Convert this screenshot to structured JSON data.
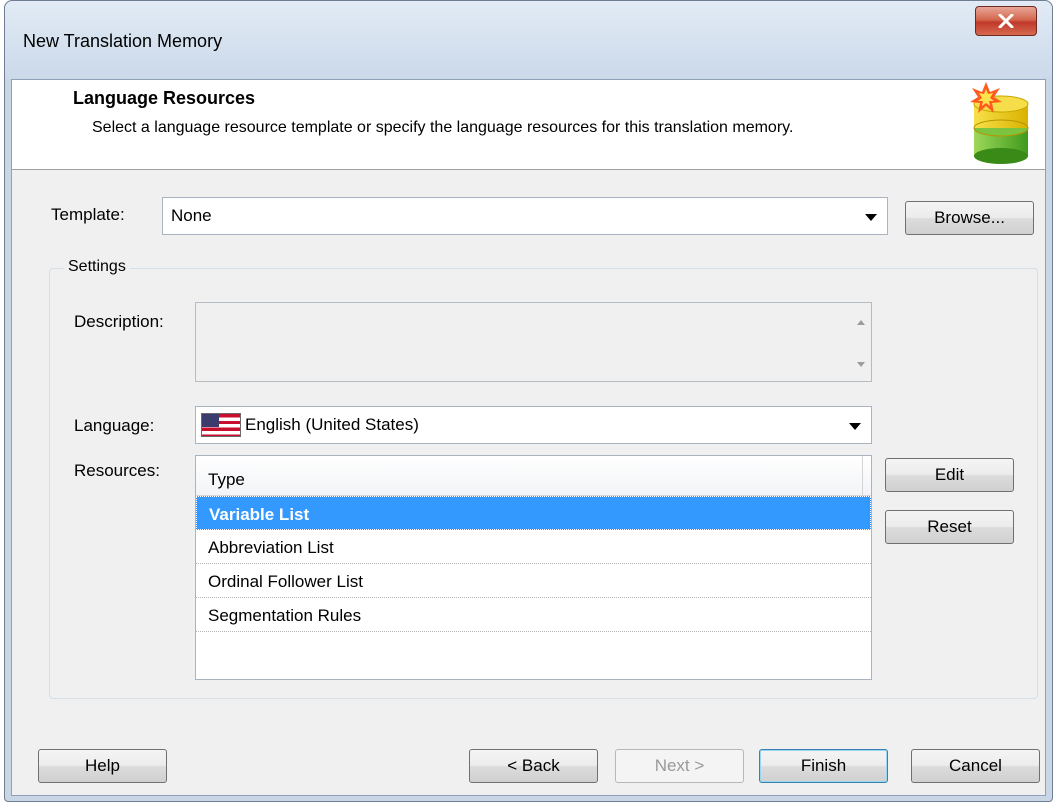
{
  "window": {
    "title": "New Translation Memory"
  },
  "header": {
    "title": "Language Resources",
    "subtitle": "Select a language resource template or specify the language resources for this translation memory."
  },
  "template": {
    "label": "Template:",
    "value": "None",
    "browse_label": "Browse..."
  },
  "settings": {
    "group_title": "Settings",
    "description_label": "Description:",
    "description_value": "",
    "language_label": "Language:",
    "language_value": "English (United States)",
    "resources_label": "Resources:",
    "resources_column": "Type",
    "resources": [
      {
        "type": "Variable List",
        "selected": true
      },
      {
        "type": "Abbreviation List",
        "selected": false
      },
      {
        "type": "Ordinal Follower List",
        "selected": false
      },
      {
        "type": "Segmentation Rules",
        "selected": false
      }
    ],
    "edit_label": "Edit",
    "reset_label": "Reset"
  },
  "footer": {
    "help_label": "Help",
    "back_label": "< Back",
    "next_label": "Next >",
    "finish_label": "Finish",
    "cancel_label": "Cancel"
  },
  "icons": {
    "close": "close-icon",
    "database": "database-icon",
    "flag": "us-flag-icon"
  }
}
